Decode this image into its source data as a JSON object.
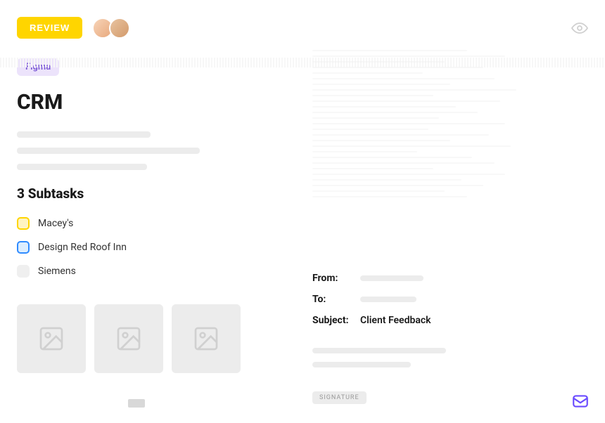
{
  "header": {
    "status_label": "REVIEW",
    "avatars": [
      "user-1",
      "user-2"
    ]
  },
  "left": {
    "tag": "Figma",
    "title": "CRM",
    "subtasks_heading": "3 Subtasks",
    "subtasks": [
      {
        "label": "Macey's",
        "color": "yellow"
      },
      {
        "label": "Design Red Roof Inn",
        "color": "blue"
      },
      {
        "label": "Siemens",
        "color": "grey"
      }
    ]
  },
  "email": {
    "from_label": "From:",
    "to_label": "To:",
    "subject_label": "Subject:",
    "subject_value": "Client Feedback",
    "signature_label": "SIGNATURE"
  }
}
